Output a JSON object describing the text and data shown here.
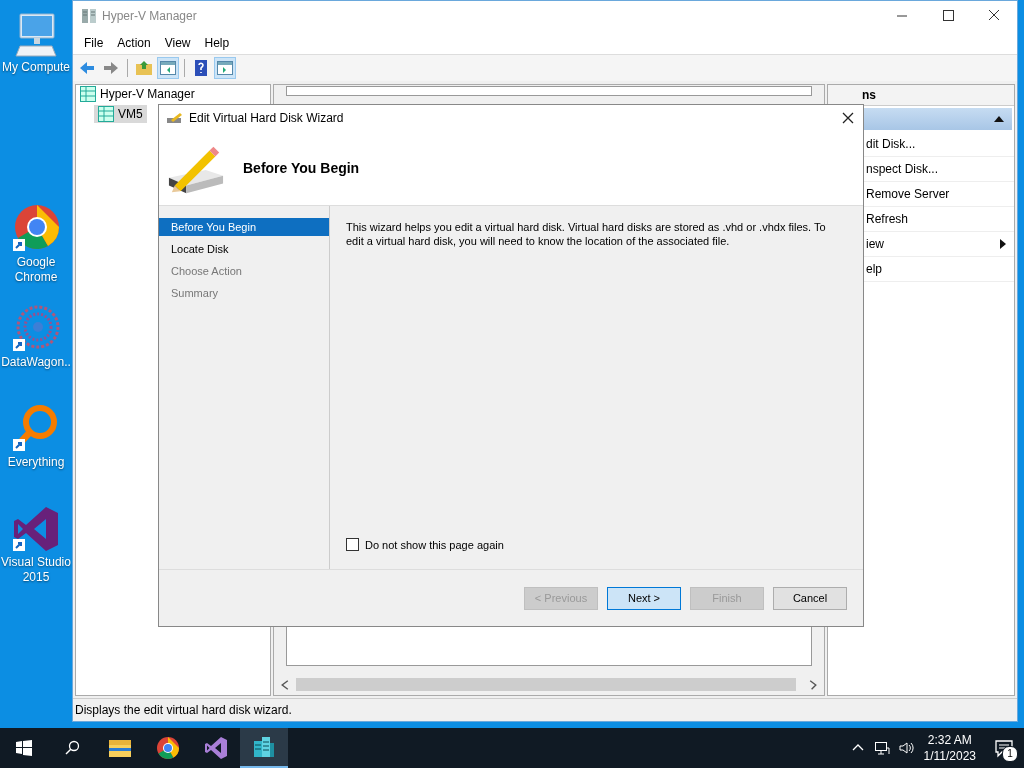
{
  "desktop_icons": [
    {
      "label": "My Compute",
      "kind": "computer"
    },
    {
      "label": "Google Chrome",
      "kind": "chrome"
    },
    {
      "label": "DataWagon..",
      "kind": "datawagon"
    },
    {
      "label": "Everything",
      "kind": "everything"
    },
    {
      "label": "Visual Studio 2015",
      "kind": "vs"
    }
  ],
  "hyperv_window": {
    "title": "Hyper-V Manager",
    "menu": [
      "File",
      "Action",
      "View",
      "Help"
    ],
    "tree": [
      {
        "label": "Hyper-V Manager",
        "selected": false,
        "children": [
          {
            "label": "VM5",
            "selected": true
          }
        ]
      }
    ],
    "actions": {
      "header": "ns",
      "items": [
        {
          "label": "dit Disk...",
          "submenu": false
        },
        {
          "label": "nspect Disk...",
          "submenu": false
        },
        {
          "label": "Remove Server",
          "submenu": false
        },
        {
          "label": "Refresh",
          "submenu": false
        },
        {
          "label": "iew",
          "submenu": true
        },
        {
          "label": "elp",
          "submenu": false
        }
      ]
    },
    "status_bar": "Displays the edit virtual hard disk wizard."
  },
  "wizard": {
    "title": "Edit Virtual Hard Disk Wizard",
    "heading": "Before You Begin",
    "steps": [
      {
        "label": "Before You Begin",
        "selected": true,
        "disabled": false
      },
      {
        "label": "Locate Disk",
        "selected": false,
        "disabled": false
      },
      {
        "label": "Choose Action",
        "selected": false,
        "disabled": true
      },
      {
        "label": "Summary",
        "selected": false,
        "disabled": true
      }
    ],
    "description": "This wizard helps you edit a virtual hard disk. Virtual hard disks are stored as .vhd or .vhdx files. To edit a virtual hard disk, you will need to know the location of the associated file.",
    "dont_show_again": {
      "label": "Do not show this page again",
      "checked": false
    },
    "buttons": [
      {
        "label": "< Previous",
        "disabled": true,
        "default": false
      },
      {
        "label": "Next >",
        "disabled": false,
        "default": true
      },
      {
        "label": "Finish",
        "disabled": true,
        "default": false
      },
      {
        "label": "Cancel",
        "disabled": false,
        "default": false
      }
    ]
  },
  "taskbar": {
    "apps": [
      {
        "kind": "explorer",
        "active": false
      },
      {
        "kind": "chrome",
        "active": false
      },
      {
        "kind": "vs",
        "active": false
      },
      {
        "kind": "hyperv",
        "active": true
      }
    ],
    "time": "2:32 AM",
    "date": "1/11/2023",
    "notifications": "1"
  }
}
